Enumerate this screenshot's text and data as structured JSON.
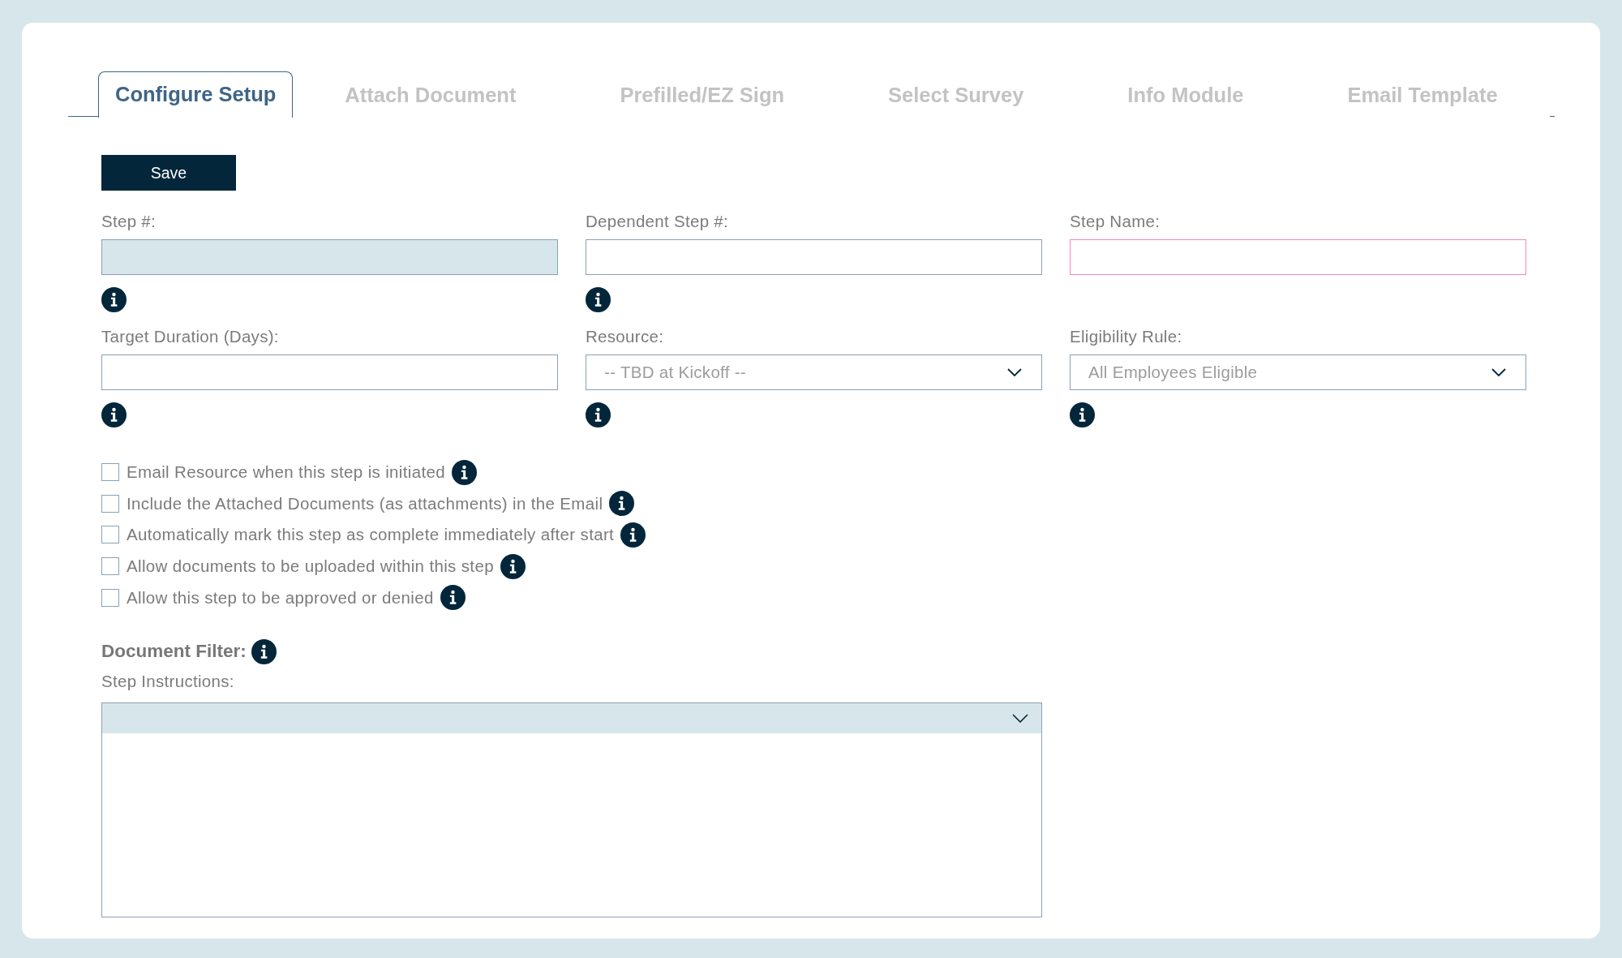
{
  "tabs": [
    {
      "label": "Configure Setup",
      "selected": true
    },
    {
      "label": "Attach Document",
      "selected": false
    },
    {
      "label": "Prefilled/EZ Sign",
      "selected": false
    },
    {
      "label": "Select Survey",
      "selected": false
    },
    {
      "label": "Info Module",
      "selected": false
    },
    {
      "label": "Email Template",
      "selected": false
    }
  ],
  "save_button": {
    "label": "Save"
  },
  "fields": [
    {
      "label": "Step #:",
      "kind": "text",
      "disabled": true,
      "invalid": false,
      "info": true
    },
    {
      "label": "Dependent Step #:",
      "kind": "text",
      "disabled": false,
      "invalid": false,
      "info": true
    },
    {
      "label": "Step Name:",
      "kind": "text",
      "disabled": false,
      "invalid": true,
      "info": false
    },
    {
      "label": "Target Duration (Days):",
      "kind": "text",
      "disabled": false,
      "invalid": false,
      "info": true
    },
    {
      "label": "Resource:",
      "kind": "select",
      "value": "-- TBD at Kickoff --",
      "disabled": false,
      "invalid": false,
      "info": true
    },
    {
      "label": "Eligibility Rule:",
      "kind": "select",
      "value": "All Employees Eligible",
      "disabled": false,
      "invalid": false,
      "info": true
    }
  ],
  "checkboxes": [
    {
      "label": "Email Resource when this step is initiated",
      "checked": false,
      "info": true
    },
    {
      "label": "Include the Attached Documents (as attachments) in the Email",
      "checked": false,
      "info": true
    },
    {
      "label": "Automatically mark this step as complete immediately after start",
      "checked": false,
      "info": true
    },
    {
      "label": "Allow documents to be uploaded within this step",
      "checked": false,
      "info": true
    },
    {
      "label": "Allow this step to be approved or denied",
      "checked": false,
      "info": true
    }
  ],
  "document_filter": {
    "label": "Document Filter:",
    "info": true
  },
  "step_instructions": {
    "label": "Step Instructions:"
  }
}
